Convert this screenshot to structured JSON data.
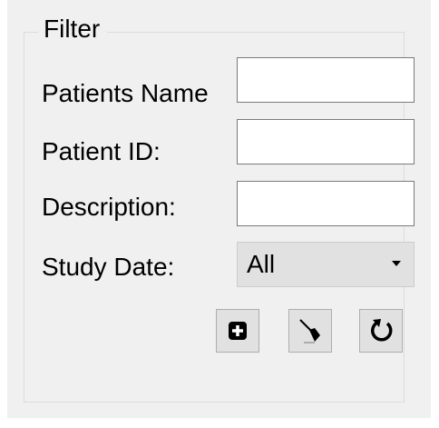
{
  "filter": {
    "title": "Filter",
    "patients_name_label": "Patients Name",
    "patients_name_value": "",
    "patient_id_label": "Patient ID:",
    "patient_id_value": "",
    "description_label": "Description:",
    "description_value": "",
    "study_date_label": "Study Date:",
    "study_date_value": "All"
  },
  "toolbar": {
    "add_icon": "plus-square-icon",
    "clear_icon": "broom-icon",
    "refresh_icon": "refresh-icon"
  }
}
